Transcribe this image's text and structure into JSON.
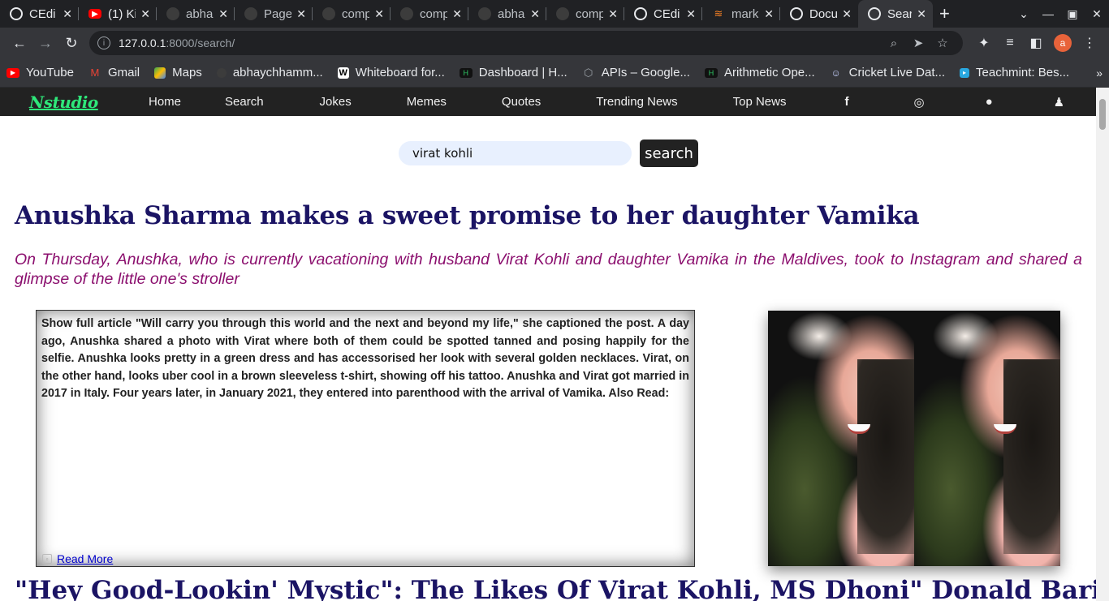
{
  "browser": {
    "tabs": [
      {
        "label": "CEdi",
        "icon": "globe-icon",
        "active": false
      },
      {
        "label": "(1) Ki",
        "icon": "youtube-icon",
        "active": false
      },
      {
        "label": "abha",
        "icon": "github-icon",
        "active": false
      },
      {
        "label": "Page",
        "icon": "github-icon",
        "active": false
      },
      {
        "label": "comp",
        "icon": "github-icon",
        "active": false
      },
      {
        "label": "comp",
        "icon": "github-icon",
        "active": false
      },
      {
        "label": "abha",
        "icon": "github-icon",
        "active": false
      },
      {
        "label": "comp",
        "icon": "github-icon",
        "active": false
      },
      {
        "label": "CEdi",
        "icon": "globe-icon",
        "active": false
      },
      {
        "label": "mark",
        "icon": "stackoverflow-icon",
        "active": false
      },
      {
        "label": "Docu",
        "icon": "globe-icon",
        "active": false
      },
      {
        "label": "Sear",
        "icon": "globe-icon",
        "active": true
      }
    ],
    "url_host": "127.0.0.1",
    "url_path": ":8000/search/",
    "profile_initial": "a",
    "bookmarks": [
      {
        "label": "YouTube",
        "color": "#ff0000"
      },
      {
        "label": "Gmail",
        "color": "#ea4335"
      },
      {
        "label": "Maps",
        "color": "#34a853"
      },
      {
        "label": "abhaychhamm...",
        "color": "#35363a"
      },
      {
        "label": "Whiteboard for...",
        "color": "#ffffff"
      },
      {
        "label": "Dashboard | H...",
        "color": "#111111"
      },
      {
        "label": "APIs – Google...",
        "color": "#5f6368"
      },
      {
        "label": "Arithmetic Ope...",
        "color": "#111111"
      },
      {
        "label": "Cricket Live Dat...",
        "color": "#3b5998"
      },
      {
        "label": "Teachmint: Bes...",
        "color": "#29a8e0"
      }
    ]
  },
  "site": {
    "logo": "Nstudio",
    "nav": [
      "Home",
      "Search",
      "Jokes",
      "Memes",
      "Quotes",
      "Trending News",
      "Top News"
    ],
    "social_icons": [
      "facebook-icon",
      "instagram-icon",
      "github-icon",
      "user-icon"
    ]
  },
  "search": {
    "query": "virat kohli",
    "button": "search"
  },
  "results": [
    {
      "title": "Anushka Sharma makes a sweet promise to her daughter Vamika",
      "description": "On Thursday, Anushka, who is currently vacationing with husband Virat Kohli and daughter Vamika in the Maldives, took to Instagram and shared a glimpse of the little one's stroller",
      "content": "Show full article \"Will carry you through this world and the next and beyond my life,\" she captioned the post. A day ago, Anushka shared a photo with Virat where both of them could be spotted tanned and posing happily for the selfie. Anushka looks pretty in a green dress and has accessorised her look with several golden necklaces. Virat, on the other hand, looks uber cool in a brown sleeveless t-shirt, showing off his tattoo. Anushka and Virat got married in 2017 in Italy. Four years later, in January 2021, they entered into parenthood with the arrival of Vamika. Also Read:",
      "read_more": "Read More"
    },
    {
      "title": "\"Hey Good-Lookin' Mystic\": The Likes Of Virat Kohli, MS Dhoni\" Donald Bari"
    }
  ],
  "colors": {
    "headline": "#1b1464",
    "description": "#8b0f6e",
    "logo": "#2ee87a",
    "nav_bg": "#222222"
  }
}
